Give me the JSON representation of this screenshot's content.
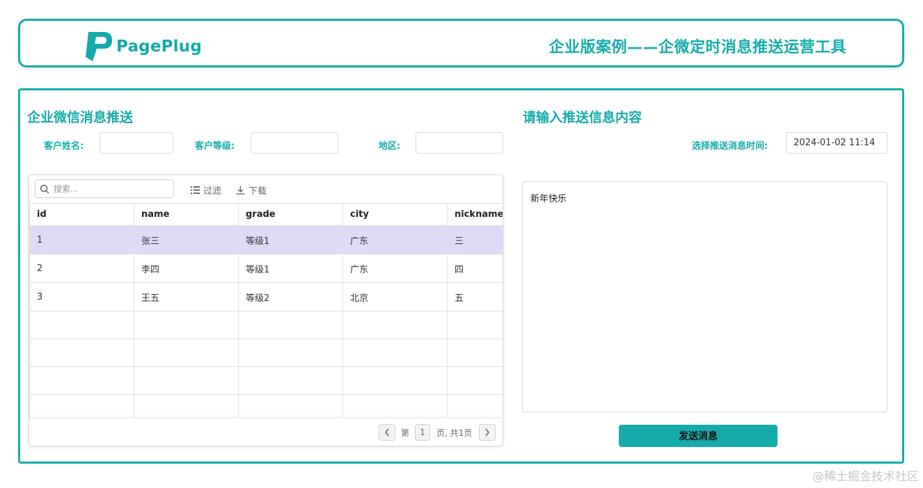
{
  "header": {
    "logo_text": "PagePlug",
    "title": "企业版案例——企微定时消息推送运营工具"
  },
  "left": {
    "title": "企业微信消息推送",
    "filters": {
      "name_label": "客户姓名:",
      "grade_label": "客户等级:",
      "region_label": "地区:",
      "name_value": "",
      "grade_value": "",
      "region_value": ""
    },
    "table": {
      "search_placeholder": "搜索...",
      "filter_label": "过滤",
      "download_label": "下载",
      "columns": [
        "id",
        "name",
        "grade",
        "city",
        "nickname"
      ],
      "rows": [
        [
          "1",
          "张三",
          "等级1",
          "广东",
          "三"
        ],
        [
          "2",
          "李四",
          "等级1",
          "广东",
          "四"
        ],
        [
          "3",
          "王五",
          "等级2",
          "北京",
          "五"
        ]
      ],
      "selected_row_index": 0,
      "pagination": {
        "prefix": "第",
        "page": "1",
        "suffix": "页, 共1页"
      }
    }
  },
  "right": {
    "title": "请输入推送信息内容",
    "time_label": "选择推送消息时间:",
    "time_value": "2024-01-02 11:14",
    "message": "新年快乐",
    "send_label": "发送消息"
  },
  "watermark": "@稀土掘金技术社区",
  "colors": {
    "accent": "#14abaa",
    "selected_row": "#dedaf8"
  }
}
